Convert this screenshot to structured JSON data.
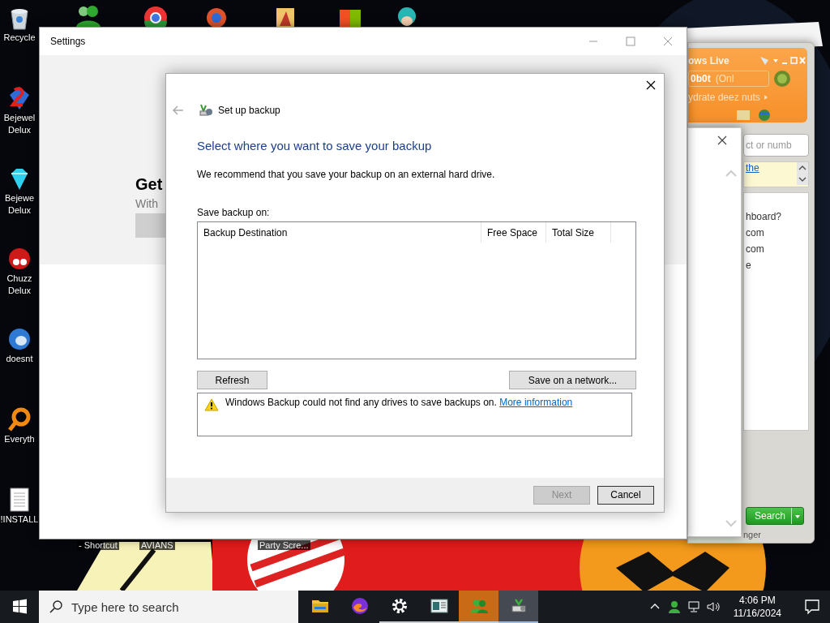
{
  "desktop_icons": [
    {
      "kind": "recycle",
      "lines": [
        "Recycle"
      ]
    },
    {
      "kind": "gem2",
      "lines": [
        "Bejewel",
        "Delux"
      ]
    },
    {
      "kind": "gem",
      "lines": [
        "Bejewe",
        "Delux"
      ]
    },
    {
      "kind": "fuzzy",
      "lines": [
        "Chuzz",
        "Delux"
      ]
    },
    {
      "kind": "bird",
      "lines": [
        "doesnt"
      ]
    },
    {
      "kind": "magnifier",
      "lines": [
        "Everyth"
      ]
    },
    {
      "kind": "document",
      "lines": [
        "!INSTALL"
      ]
    }
  ],
  "desktop_labels": [
    "- Shortcut",
    "AVIANS",
    "Party Scre..."
  ],
  "settings_window": {
    "title": "Settings",
    "heading": "Get",
    "subtext": "With"
  },
  "messenger_window": {
    "title": "ows Live",
    "user": "0b0t",
    "status": "(Onl",
    "personal_message": "ydrate deez nuts",
    "search_placeholder": "ct or numb",
    "news_link": "the",
    "lines": [
      "hboard?",
      "com",
      "com",
      "e"
    ],
    "search_button": "Search",
    "footer": "nger"
  },
  "backup_dialog": {
    "title": "Set up backup",
    "heading": "Select where you want to save your backup",
    "description": "We recommend that you save your backup on an external hard drive.",
    "list_label": "Save backup on:",
    "columns": [
      "Backup Destination",
      "Free Space",
      "Total Size"
    ],
    "refresh_button": "Refresh",
    "network_button": "Save on a network...",
    "message": "Windows Backup could not find any drives to save backups on.",
    "message_link": "More information",
    "next_button": {
      "label": "Next",
      "disabled": true
    },
    "cancel_button": {
      "label": "Cancel",
      "disabled": false
    }
  },
  "taskbar": {
    "search_placeholder": "Type here to search",
    "apps": [
      {
        "kind": "folder",
        "running": false,
        "flashing": false,
        "selected": false
      },
      {
        "kind": "browser",
        "running": false,
        "flashing": false,
        "selected": false
      },
      {
        "kind": "gear",
        "running": true,
        "flashing": false,
        "selected": false
      },
      {
        "kind": "window",
        "running": true,
        "flashing": false,
        "selected": false
      },
      {
        "kind": "people",
        "running": true,
        "flashing": true,
        "selected": false
      },
      {
        "kind": "backup",
        "running": true,
        "flashing": false,
        "selected": true
      }
    ],
    "time": "4:06 PM",
    "date": "11/16/2024"
  }
}
